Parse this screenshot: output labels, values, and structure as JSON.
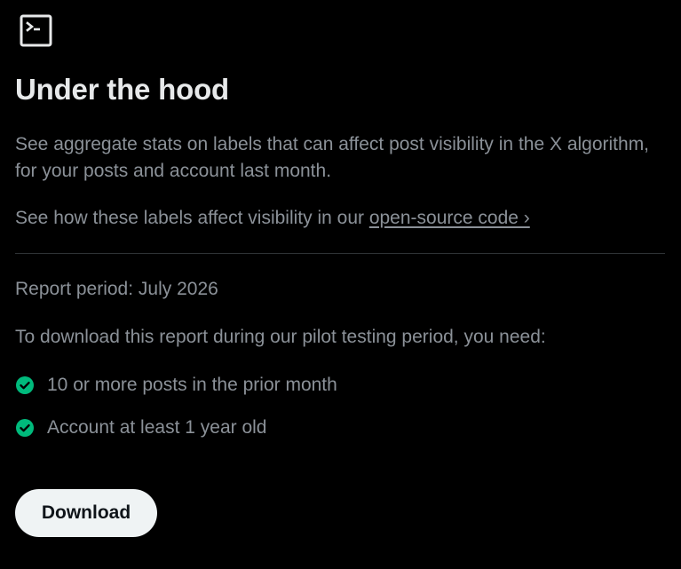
{
  "icon": "terminal-icon",
  "title": "Under the hood",
  "description": "See aggregate stats on labels that can affect post visibility in the X algorithm, for your posts and account last month.",
  "source": {
    "prefix": "See how these labels affect visibility in our ",
    "link_text": "open-source code ›"
  },
  "report_period": "Report period: July 2026",
  "requirements_intro": "To download this report during our pilot testing period, you need:",
  "requirements": [
    {
      "label": "10 or more posts in the prior month",
      "met": true,
      "icon": "check-circle-icon"
    },
    {
      "label": "Account at least 1 year old",
      "met": true,
      "icon": "check-circle-icon"
    }
  ],
  "download_label": "Download",
  "colors": {
    "background": "#000000",
    "title": "#e7e9ea",
    "muted_text": "#8b9198",
    "check_green": "#00ba7c",
    "button_bg": "#eff3f4",
    "button_text": "#0f1419",
    "divider": "#2f3336"
  }
}
